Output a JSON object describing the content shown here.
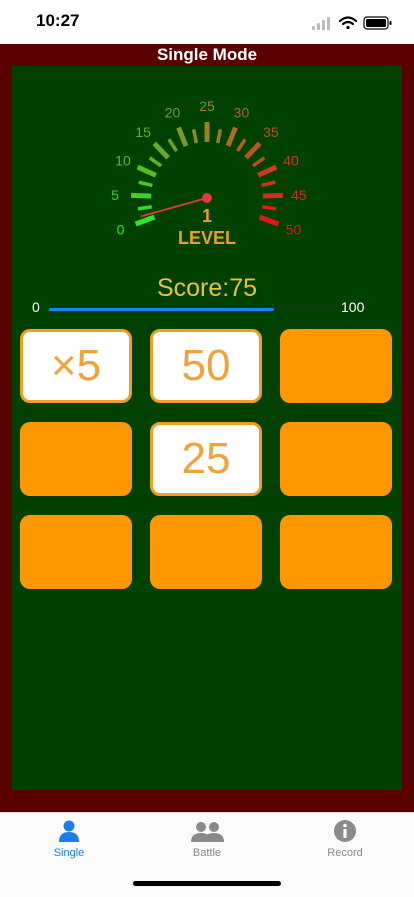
{
  "status": {
    "time": "10:27"
  },
  "header": {
    "title": "Single Mode"
  },
  "gauge": {
    "ticks": [
      "0",
      "5",
      "10",
      "15",
      "20",
      "25",
      "30",
      "35",
      "40",
      "45",
      "50"
    ],
    "level_number": "1",
    "level_label": "LEVEL",
    "needle_value": 1
  },
  "score": {
    "text": "Score:75",
    "progress": {
      "min": "0",
      "max": "100",
      "value": 75
    }
  },
  "cards": [
    {
      "value": "×5",
      "revealed": true
    },
    {
      "value": "50",
      "revealed": true
    },
    {
      "value": "",
      "revealed": false
    },
    {
      "value": "",
      "revealed": false
    },
    {
      "value": "25",
      "revealed": true
    },
    {
      "value": "",
      "revealed": false
    },
    {
      "value": "",
      "revealed": false
    },
    {
      "value": "",
      "revealed": false
    },
    {
      "value": "",
      "revealed": false
    }
  ],
  "tabs": [
    {
      "label": "Single",
      "icon": "person-icon",
      "active": true
    },
    {
      "label": "Battle",
      "icon": "people-icon",
      "active": false
    },
    {
      "label": "Record",
      "icon": "info-icon",
      "active": false
    }
  ],
  "colors": {
    "board": "#004100",
    "frame": "#5a0000",
    "card": "#ff9800",
    "accent": "#1c84ff",
    "level": "#e8a020",
    "score": "#e8c23a"
  }
}
